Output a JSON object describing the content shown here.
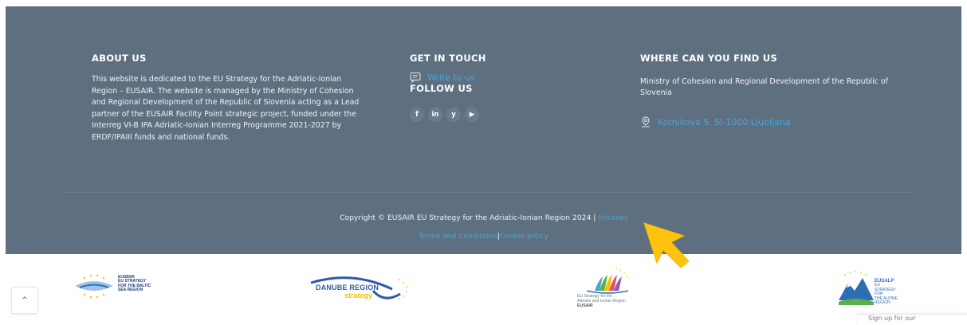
{
  "about": {
    "heading": "ABOUT US",
    "text": "This website is dedicated to the EU Strategy for the Adriatic-Ionian Region – EUSAIR. The website is managed by the Ministry of Cohesion and Regional Development of the Republic of Slovenia acting as a Lead partner of the EUSAIR Facility Point strategic project, funded under the Interreg VI-B IPA Adriatic-Ionian Interreg Programme 2021-2027 by ERDF/IPAIII funds and national funds."
  },
  "contact": {
    "heading": "GET IN TOUCH",
    "write_label": "Write to us",
    "write_icon": "message-icon"
  },
  "follow": {
    "heading": "FOLLOW US",
    "icons": [
      {
        "name": "facebook-icon",
        "glyph": "f"
      },
      {
        "name": "linkedin-icon",
        "glyph": "in"
      },
      {
        "name": "twitter-icon",
        "glyph": "y"
      },
      {
        "name": "youtube-icon",
        "glyph": "▶"
      }
    ]
  },
  "location": {
    "heading": "WHERE CAN YOU FIND US",
    "org": "Ministry of Cohesion and Regional Development of the Republic of Slovenia",
    "address": "Kotnikova 5, SI-1000 Ljubljana",
    "address_icon": "map-pin-icon"
  },
  "bottom": {
    "copyright": "Copyright © EUSAIR EU Strategy for the Adriatic-Ionian Region 2024 |",
    "intranet": "Intranet",
    "terms": "Terms and Conditions",
    "separator": "|",
    "cookie": "Cookie policy"
  },
  "partners": {
    "eusbsr": {
      "title": "EUSBSR",
      "line1": "EU STRATEGY",
      "line2": "FOR THE BALTIC",
      "line3": "SEA REGION"
    },
    "danube": {
      "line1": "DANUBE REGION",
      "line2": "strategy"
    },
    "eusair": {
      "line1": "EU Strategy for the",
      "line2": "Adriatic and Ionian Region",
      "line3": "EUSAIR"
    },
    "eusalp": {
      "title": "EUSALP",
      "line1": "EU STRATEGY FOR",
      "line2": "THE ALPINE REGION"
    }
  },
  "widget": {
    "scroll_top_glyph": "^",
    "corner_text": "Sign up for our"
  },
  "colors": {
    "footer_bg": "#5e6f80",
    "link": "#4aa4d6",
    "cursor": "#ffc20e"
  }
}
